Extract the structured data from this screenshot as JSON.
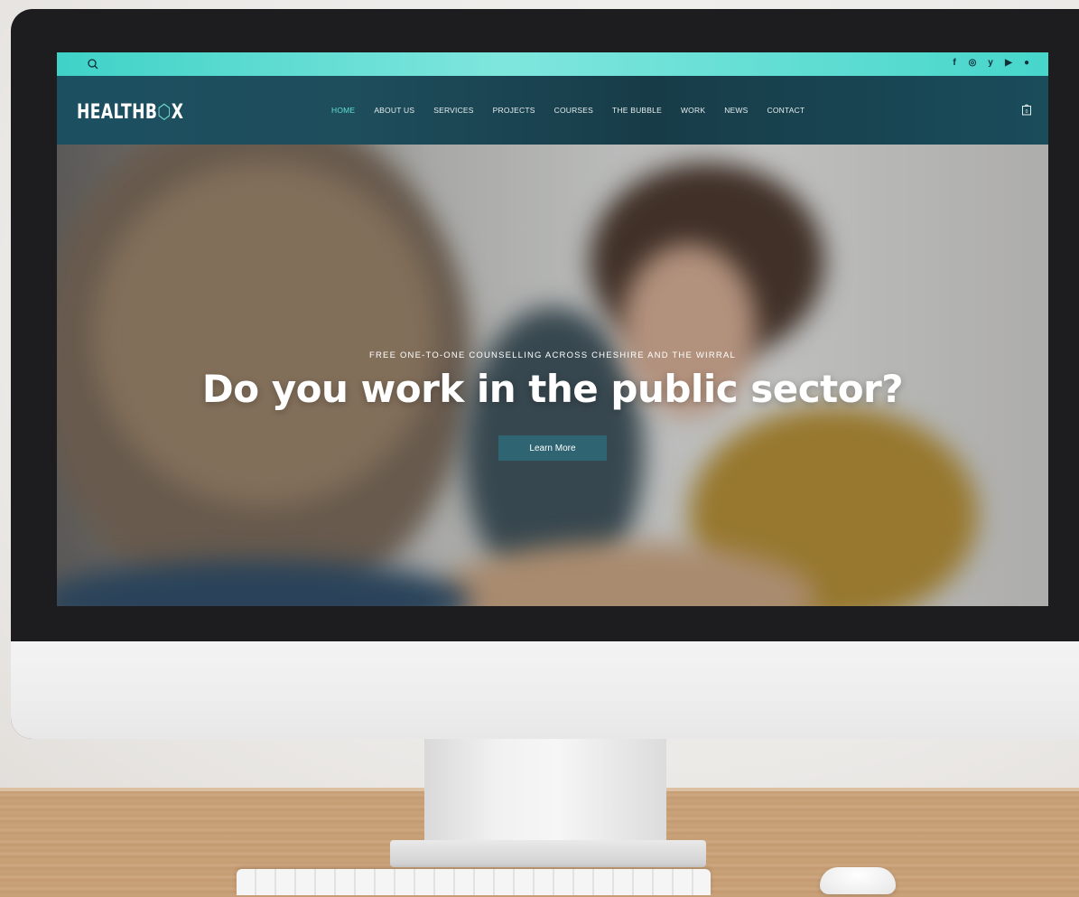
{
  "site": {
    "logo": {
      "text_prefix": "HEALTHB",
      "text_box_letter": "⬡",
      "text_suffix": "X"
    },
    "topbar": {
      "search_icon": "search-icon",
      "social_icons": [
        "facebook-icon",
        "instagram-icon",
        "twitter-icon",
        "youtube-icon",
        "spotify-icon"
      ],
      "social_glyphs": [
        "f",
        "◎",
        "y",
        "▶",
        "●"
      ]
    },
    "nav": {
      "items": [
        {
          "label": "HOME",
          "active": true
        },
        {
          "label": "ABOUT US",
          "active": false
        },
        {
          "label": "SERVICES",
          "active": false
        },
        {
          "label": "PROJECTS",
          "active": false
        },
        {
          "label": "COURSES",
          "active": false
        },
        {
          "label": "THE BUBBLE",
          "active": false
        },
        {
          "label": "WORK",
          "active": false
        },
        {
          "label": "NEWS",
          "active": false
        },
        {
          "label": "CONTACT",
          "active": false
        }
      ],
      "cart_count": "0"
    },
    "hero": {
      "subtitle": "FREE ONE-TO-ONE COUNSELLING ACROSS CHESHIRE AND THE WIRRAL",
      "title": "Do you work in the public sector?",
      "button_label": "Learn More"
    },
    "colors": {
      "accent": "#5fe0d4",
      "topbar": "#3fd2c7",
      "nav_bg": "#1c5061",
      "button": "#2f6472"
    }
  }
}
